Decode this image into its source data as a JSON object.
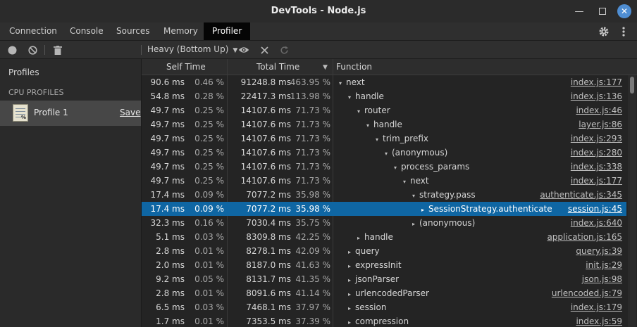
{
  "window": {
    "title": "DevTools - Node.js"
  },
  "tabs": [
    {
      "label": "Connection"
    },
    {
      "label": "Console"
    },
    {
      "label": "Sources"
    },
    {
      "label": "Memory"
    },
    {
      "label": "Profiler"
    }
  ],
  "active_tab": "Profiler",
  "toolbar": {
    "view_select": "Heavy (Bottom Up)"
  },
  "sidebar": {
    "heading": "Profiles",
    "section": "CPU PROFILES",
    "profile": {
      "label": "Profile 1",
      "save": "Save"
    }
  },
  "columns": {
    "self": "Self Time",
    "total": "Total Time",
    "function": "Function"
  },
  "rows": [
    {
      "self": "90.6 ms",
      "self_pct": "0.46 %",
      "total": "91248.8 ms",
      "total_pct": "463.95 %",
      "func": "next",
      "depth": 0,
      "arrow": "down",
      "link": "index.js:177"
    },
    {
      "self": "54.8 ms",
      "self_pct": "0.28 %",
      "total": "22417.3 ms",
      "total_pct": "113.98 %",
      "func": "handle",
      "depth": 1,
      "arrow": "down",
      "link": "index.js:136"
    },
    {
      "self": "49.7 ms",
      "self_pct": "0.25 %",
      "total": "14107.6 ms",
      "total_pct": "71.73 %",
      "func": "router",
      "depth": 2,
      "arrow": "down",
      "link": "index.js:46"
    },
    {
      "self": "49.7 ms",
      "self_pct": "0.25 %",
      "total": "14107.6 ms",
      "total_pct": "71.73 %",
      "func": "handle",
      "depth": 3,
      "arrow": "down",
      "link": "layer.js:86"
    },
    {
      "self": "49.7 ms",
      "self_pct": "0.25 %",
      "total": "14107.6 ms",
      "total_pct": "71.73 %",
      "func": "trim_prefix",
      "depth": 4,
      "arrow": "down",
      "link": "index.js:293"
    },
    {
      "self": "49.7 ms",
      "self_pct": "0.25 %",
      "total": "14107.6 ms",
      "total_pct": "71.73 %",
      "func": "(anonymous)",
      "depth": 5,
      "arrow": "down",
      "link": "index.js:280"
    },
    {
      "self": "49.7 ms",
      "self_pct": "0.25 %",
      "total": "14107.6 ms",
      "total_pct": "71.73 %",
      "func": "process_params",
      "depth": 6,
      "arrow": "down",
      "link": "index.js:338"
    },
    {
      "self": "49.7 ms",
      "self_pct": "0.25 %",
      "total": "14107.6 ms",
      "total_pct": "71.73 %",
      "func": "next",
      "depth": 7,
      "arrow": "down",
      "link": "index.js:177"
    },
    {
      "self": "17.4 ms",
      "self_pct": "0.09 %",
      "total": "7077.2 ms",
      "total_pct": "35.98 %",
      "func": "strategy.pass",
      "depth": 8,
      "arrow": "down",
      "link": "authenticate.js:345"
    },
    {
      "self": "17.4 ms",
      "self_pct": "0.09 %",
      "total": "7077.2 ms",
      "total_pct": "35.98 %",
      "func": "SessionStrategy.authenticate",
      "depth": 9,
      "arrow": "right",
      "link": "session.js:45",
      "selected": true
    },
    {
      "self": "32.3 ms",
      "self_pct": "0.16 %",
      "total": "7030.4 ms",
      "total_pct": "35.75 %",
      "func": "(anonymous)",
      "depth": 8,
      "arrow": "right",
      "link": "index.js:640"
    },
    {
      "self": "5.1 ms",
      "self_pct": "0.03 %",
      "total": "8309.8 ms",
      "total_pct": "42.25 %",
      "func": "handle",
      "depth": 2,
      "arrow": "right",
      "link": "application.js:165"
    },
    {
      "self": "2.8 ms",
      "self_pct": "0.01 %",
      "total": "8278.1 ms",
      "total_pct": "42.09 %",
      "func": "query",
      "depth": 1,
      "arrow": "right",
      "link": "query.js:39"
    },
    {
      "self": "2.0 ms",
      "self_pct": "0.01 %",
      "total": "8187.0 ms",
      "total_pct": "41.63 %",
      "func": "expressInit",
      "depth": 1,
      "arrow": "right",
      "link": "init.js:29"
    },
    {
      "self": "9.2 ms",
      "self_pct": "0.05 %",
      "total": "8131.7 ms",
      "total_pct": "41.35 %",
      "func": "jsonParser",
      "depth": 1,
      "arrow": "right",
      "link": "json.js:98"
    },
    {
      "self": "2.8 ms",
      "self_pct": "0.01 %",
      "total": "8091.6 ms",
      "total_pct": "41.14 %",
      "func": "urlencodedParser",
      "depth": 1,
      "arrow": "right",
      "link": "urlencoded.js:79"
    },
    {
      "self": "6.5 ms",
      "self_pct": "0.03 %",
      "total": "7468.1 ms",
      "total_pct": "37.97 %",
      "func": "session",
      "depth": 1,
      "arrow": "right",
      "link": "index.js:179"
    },
    {
      "self": "1.7 ms",
      "self_pct": "0.01 %",
      "total": "7353.5 ms",
      "total_pct": "37.39 %",
      "func": "compression",
      "depth": 1,
      "arrow": "right",
      "link": "index.js:59"
    }
  ],
  "colors": {
    "selection": "#0f66a3",
    "close_button": "#4f8ed3"
  }
}
